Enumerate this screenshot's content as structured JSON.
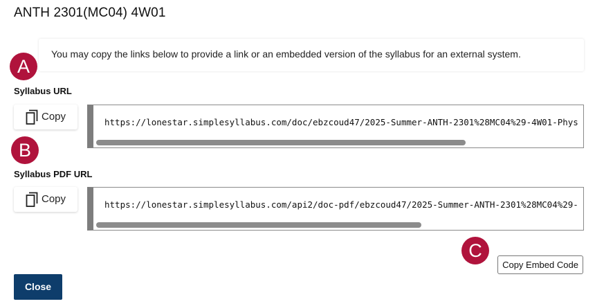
{
  "dialog": {
    "title": "ANTH 2301(MC04) 4W01",
    "info_text": "You may copy the links below to provide a link or an embedded version of the syllabus for an external system."
  },
  "markers": {
    "a": "A",
    "b": "B",
    "c": "C"
  },
  "syllabus_url": {
    "label": "Syllabus URL",
    "copy_label": "Copy",
    "value": "https://lonestar.simplesyllabus.com/doc/ebzcoud47/2025-Summer-ANTH-2301%28MC04%29-4W01-Phys"
  },
  "syllabus_pdf_url": {
    "label": "Syllabus PDF URL",
    "copy_label": "Copy",
    "value": "https://lonestar.simplesyllabus.com/api2/doc-pdf/ebzcoud47/2025-Summer-ANTH-2301%28MC04%29-"
  },
  "actions": {
    "embed_label": "Copy Embed Code",
    "close_label": "Close"
  },
  "colors": {
    "marker": "#b0133c",
    "close_button": "#0e3d6b"
  },
  "icons": {
    "copy": "copy-icon"
  }
}
